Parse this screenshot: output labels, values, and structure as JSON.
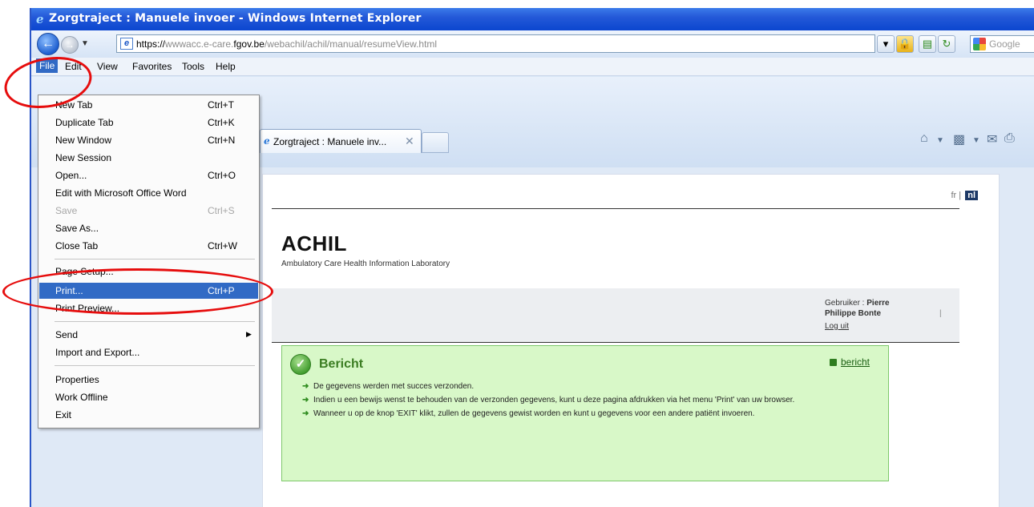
{
  "window": {
    "title": "Zorgtraject : Manuele invoer - Windows Internet Explorer"
  },
  "address": {
    "url_scheme": "https://",
    "url_host_prefix": "wwwacc.e-care.",
    "url_host_main": "fgov.be",
    "url_path": "/webachil/achil/manual/resumeView.html",
    "search_placeholder": "Google"
  },
  "menubar": {
    "items": [
      "File",
      "Edit",
      "View",
      "Favorites",
      "Tools",
      "Help"
    ]
  },
  "tabs": {
    "active_label": "Zorgtraject : Manuele inv...",
    "close_glyph": "✕"
  },
  "file_menu": {
    "items": [
      {
        "label": "New Tab",
        "shortcut": "Ctrl+T"
      },
      {
        "label": "Duplicate Tab",
        "shortcut": "Ctrl+K"
      },
      {
        "label": "New Window",
        "shortcut": "Ctrl+N"
      },
      {
        "label": "New Session",
        "shortcut": ""
      },
      {
        "label": "Open...",
        "shortcut": "Ctrl+O"
      },
      {
        "label": "Edit with Microsoft Office Word",
        "shortcut": ""
      },
      {
        "label": "Save",
        "shortcut": "Ctrl+S",
        "disabled": true
      },
      {
        "label": "Save As...",
        "shortcut": ""
      },
      {
        "label": "Close Tab",
        "shortcut": "Ctrl+W"
      },
      {
        "label": "Page Setup...",
        "shortcut": ""
      },
      {
        "label": "Print...",
        "shortcut": "Ctrl+P",
        "highlighted": true
      },
      {
        "label": "Print Preview...",
        "shortcut": ""
      },
      {
        "label": "Send",
        "shortcut": ""
      },
      {
        "label": "Import and Export...",
        "shortcut": ""
      },
      {
        "label": "Properties",
        "shortcut": ""
      },
      {
        "label": "Work Offline",
        "shortcut": ""
      },
      {
        "label": "Exit",
        "shortcut": ""
      }
    ]
  },
  "page": {
    "lang_fr": "fr",
    "lang_sep": "|",
    "lang_nl": "nl",
    "brand": "ACHIL",
    "tagline": "Ambulatory Care Health Information Laboratory",
    "user_label": "Gebruiker :",
    "user_first": "Pierre",
    "user_rest": "Philippe Bonte",
    "logout": "Log uit",
    "separator": "|"
  },
  "message": {
    "title": "Bericht",
    "collapse_label": "bericht",
    "lines": [
      "De gegevens werden met succes verzonden.",
      "Indien u een bewijs wenst te behouden van de verzonden gegevens, kunt u deze pagina afdrukken via het menu 'Print' van uw browser.",
      "Wanneer u op de knop 'EXIT' klikt, zullen de gegevens gewist worden en kunt u gegevens voor een andere patiënt invoeren."
    ]
  },
  "colors": {
    "titlebar": "#0b46cf",
    "menu_highlight": "#316ac5",
    "annotation_red": "#e60d0d",
    "message_bg": "#d8f8c8"
  }
}
